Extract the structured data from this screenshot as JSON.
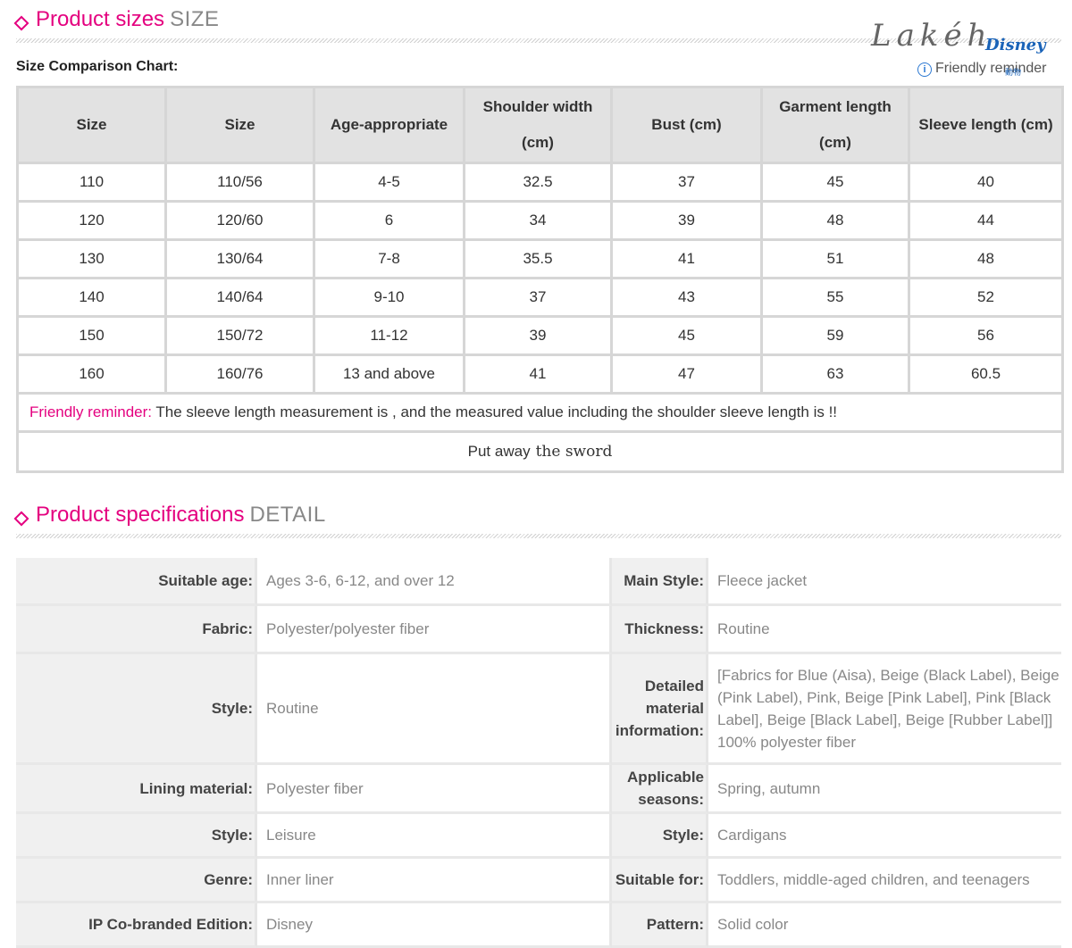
{
  "size_section": {
    "title": "Product sizes",
    "subtitle": "SIZE"
  },
  "chart_label": "Size Comparison Chart:",
  "brand": {
    "signature": "Lakéh",
    "logo": "Disney",
    "sticker": "動物",
    "info_icon": "i",
    "reminder": "Friendly reminder"
  },
  "size_table": {
    "headers": [
      "Size",
      "Size",
      "Age-appropriate",
      "Shoulder width (cm)",
      "Bust (cm)",
      "Garment length (cm)",
      "Sleeve length (cm)"
    ],
    "rows": [
      [
        "110",
        "110/56",
        "4-5",
        "32.5",
        "37",
        "45",
        "40"
      ],
      [
        "120",
        "120/60",
        "6",
        "34",
        "39",
        "48",
        "44"
      ],
      [
        "130",
        "130/64",
        "7-8",
        "35.5",
        "41",
        "51",
        "48"
      ],
      [
        "140",
        "140/64",
        "9-10",
        "37",
        "43",
        "55",
        "52"
      ],
      [
        "150",
        "150/72",
        "11-12",
        "39",
        "45",
        "59",
        "56"
      ],
      [
        "160",
        "160/76",
        "13 and above",
        "41",
        "47",
        "63",
        "60.5"
      ]
    ],
    "reminder_label": "Friendly reminder:",
    "reminder_text": " The sleeve length measurement is , and the measured value including the shoulder sleeve length is !!",
    "put_away_a": "Put away",
    "put_away_b": "the  sword"
  },
  "spec_section": {
    "title": "Product specifications",
    "subtitle": "DETAIL"
  },
  "specs": {
    "left": [
      {
        "label": "Suitable age:",
        "value": "Ages 3-6, 6-12, and over 12"
      },
      {
        "label": "Fabric:",
        "value": "Polyester/polyester fiber"
      },
      {
        "label": "Style:",
        "value": "Routine"
      },
      {
        "label": "Lining material:",
        "value": "Polyester fiber"
      },
      {
        "label": "Style:",
        "value": "Leisure"
      },
      {
        "label": "Genre:",
        "value": "Inner liner"
      },
      {
        "label": "IP Co-branded Edition:",
        "value": "Disney"
      }
    ],
    "right": [
      {
        "label": "Main Style:",
        "value": "Fleece jacket"
      },
      {
        "label": "Thickness:",
        "value": "Routine"
      },
      {
        "label": "Detailed material information:",
        "value": "[Fabrics for Blue (Aisa), Beige (Black Label), Beige (Pink Label), Pink, Beige [Pink Label], Pink [Black Label], Beige [Black Label], Beige [Rubber Label]] 100% polyester fiber"
      },
      {
        "label": "Applicable seasons:",
        "value": "Spring, autumn"
      },
      {
        "label": "Style:",
        "value": "Cardigans"
      },
      {
        "label": "Suitable for:",
        "value": "Toddlers, middle-aged children, and teenagers"
      },
      {
        "label": "Pattern:",
        "value": "Solid color"
      }
    ]
  }
}
